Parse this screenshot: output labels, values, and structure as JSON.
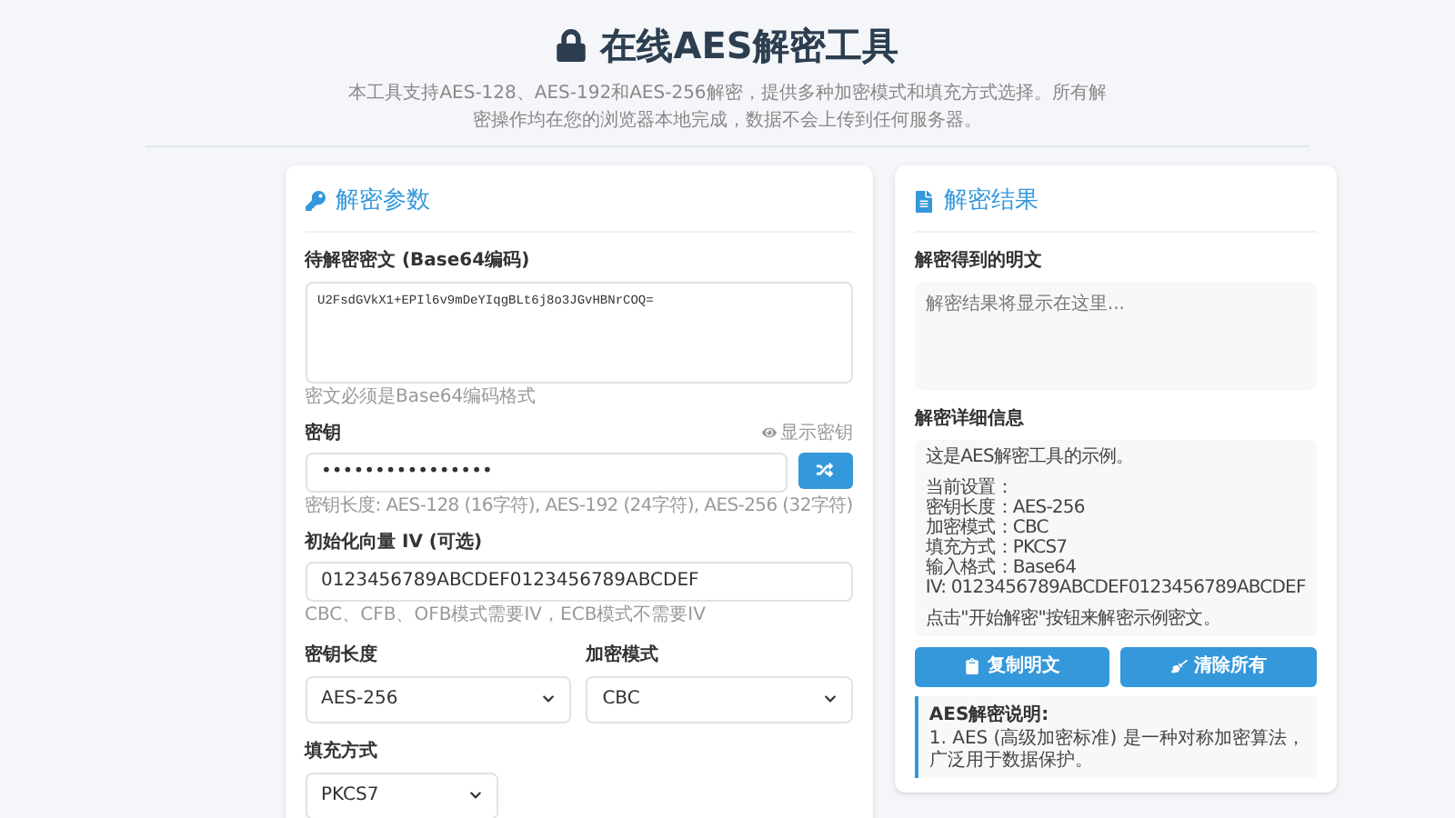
{
  "header": {
    "title": "在线AES解密工具",
    "description": "本工具支持AES-128、AES-192和AES-256解密，提供多种加密模式和填充方式选择。所有解密操作均在您的浏览器本地完成，数据不会上传到任何服务器。"
  },
  "params_panel": {
    "title": "解密参数",
    "ciphertext": {
      "label": "待解密密文 (Base64编码)",
      "value": "U2FsdGVkX1+EPIl6v9mDeYIqgBLt6j8o3JGvHBNrCOQ=",
      "hint": "密文必须是Base64编码格式"
    },
    "key": {
      "label": "密钥",
      "toggle": "显示密钥",
      "value": "••••••••••••••••",
      "hint": "密钥长度: AES-128 (16字符), AES-192 (24字符), AES-256 (32字符)"
    },
    "iv": {
      "label": "初始化向量 IV (可选)",
      "value": "0123456789ABCDEF0123456789ABCDEF",
      "hint": "CBC、CFB、OFB模式需要IV，ECB模式不需要IV"
    },
    "selects": [
      {
        "label": "密钥长度",
        "value": "AES-256"
      },
      {
        "label": "加密模式",
        "value": "CBC"
      }
    ],
    "padding": {
      "label": "填充方式",
      "value": "PKCS7"
    }
  },
  "result_panel": {
    "title": "解密结果",
    "plaintext": {
      "label": "解密得到的明文",
      "placeholder": "解密结果将显示在这里..."
    },
    "details": {
      "label": "解密详细信息",
      "paragraphs": [
        [
          "这是AES解密工具的示例。"
        ],
        [
          "当前设置：",
          "密钥长度：AES-256",
          "加密模式：CBC",
          "填充方式：PKCS7",
          "输入格式：Base64",
          "IV: 0123456789ABCDEF0123456789ABCDEF"
        ],
        [
          "点击\"开始解密\"按钮来解密示例密文。"
        ]
      ]
    },
    "buttons": [
      {
        "kind": "copy",
        "label": "复制明文"
      },
      {
        "kind": "clear",
        "label": "清除所有"
      }
    ],
    "note": {
      "title": "AES解密说明:",
      "items": [
        "1. AES (高级加密标准) 是一种对称加密算法，广泛用于数据保护。"
      ]
    }
  }
}
